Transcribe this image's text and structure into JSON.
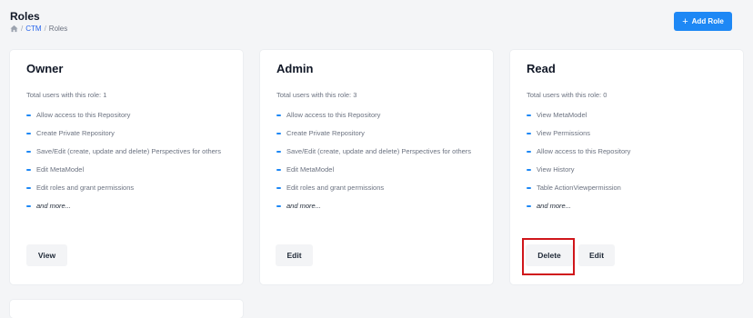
{
  "header": {
    "title": "Roles",
    "breadcrumb": {
      "home_icon": "home-icon",
      "sep1": "/",
      "link": "CTM",
      "sep2": "/",
      "current": "Roles"
    },
    "add_button": {
      "icon": "plus-icon",
      "label": "Add Role"
    }
  },
  "cards": [
    {
      "title": "Owner",
      "users": "Total users with this role: 1",
      "permissions": [
        "Allow access to this Repository",
        "Create Private Repository",
        "Save/Edit (create, update and delete) Perspectives for others",
        "Edit MetaModel",
        "Edit roles and grant permissions"
      ],
      "more": "and more...",
      "buttons": [
        "View"
      ]
    },
    {
      "title": "Admin",
      "users": "Total users with this role: 3",
      "permissions": [
        "Allow access to this Repository",
        "Create Private Repository",
        "Save/Edit (create, update and delete) Perspectives for others",
        "Edit MetaModel",
        "Edit roles and grant permissions"
      ],
      "more": "and more...",
      "buttons": [
        "Edit"
      ]
    },
    {
      "title": "Read",
      "users": "Total users with this role: 0",
      "permissions": [
        "View MetaModel",
        "View Permissions",
        "Allow access to this Repository",
        "View History",
        "Table ActionViewpermission"
      ],
      "more": "and more...",
      "buttons": [
        "Delete",
        "Edit"
      ]
    }
  ],
  "colors": {
    "accent": "#1e88f5",
    "highlight": "#d0161b"
  }
}
